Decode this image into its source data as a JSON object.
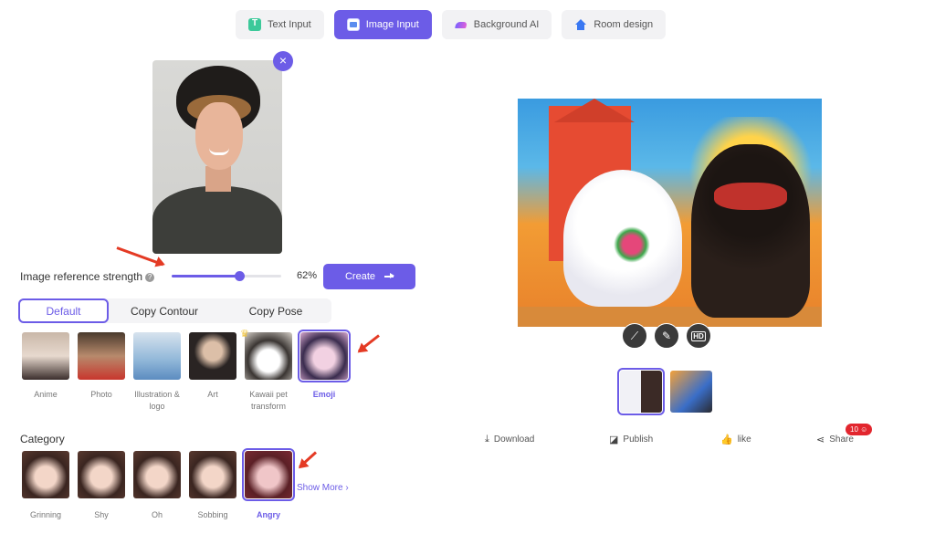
{
  "tabs": [
    {
      "label": "Text Input",
      "icon": "text-input-icon"
    },
    {
      "label": "Image Input",
      "icon": "image-input-icon",
      "active": true
    },
    {
      "label": "Background AI",
      "icon": "background-ai-icon"
    },
    {
      "label": "Room design",
      "icon": "room-design-icon"
    }
  ],
  "upload": {
    "close_glyph": "×"
  },
  "strength": {
    "label": "Image reference strength",
    "help_glyph": "?",
    "value": 62,
    "value_text": "62%"
  },
  "create_button": {
    "label": "Create"
  },
  "modes": [
    "Default",
    "Copy Contour",
    "Copy Pose"
  ],
  "styles": [
    {
      "label": "Anime"
    },
    {
      "label": "Photo"
    },
    {
      "label": "Illustration & logo"
    },
    {
      "label": "Art"
    },
    {
      "label": "Kawaii pet transform"
    },
    {
      "label": "Emoji",
      "selected": true
    }
  ],
  "category": {
    "title": "Category",
    "items": [
      "Grinning",
      "Shy",
      "Oh",
      "Sobbing",
      "Angry"
    ],
    "selected": "Angry",
    "show_more": "Show More ›"
  },
  "result_tools": [
    {
      "name": "magic-wand-icon",
      "glyph": "⟋"
    },
    {
      "name": "edit-icon",
      "glyph": "✎"
    },
    {
      "name": "hd-icon",
      "glyph": "HD"
    }
  ],
  "actions": [
    {
      "label": "Download",
      "icon": "download-icon",
      "glyph": "⤓"
    },
    {
      "label": "Publish",
      "icon": "publish-icon",
      "glyph": "◪"
    },
    {
      "label": "like",
      "icon": "like-icon",
      "glyph": "👍"
    },
    {
      "label": "Share",
      "icon": "share-icon",
      "glyph": "⋖"
    }
  ],
  "share_badge": "10 ☺",
  "colors": {
    "accent": "#6c5ce7",
    "arrow": "#e43a24",
    "badge": "#e2262e"
  }
}
